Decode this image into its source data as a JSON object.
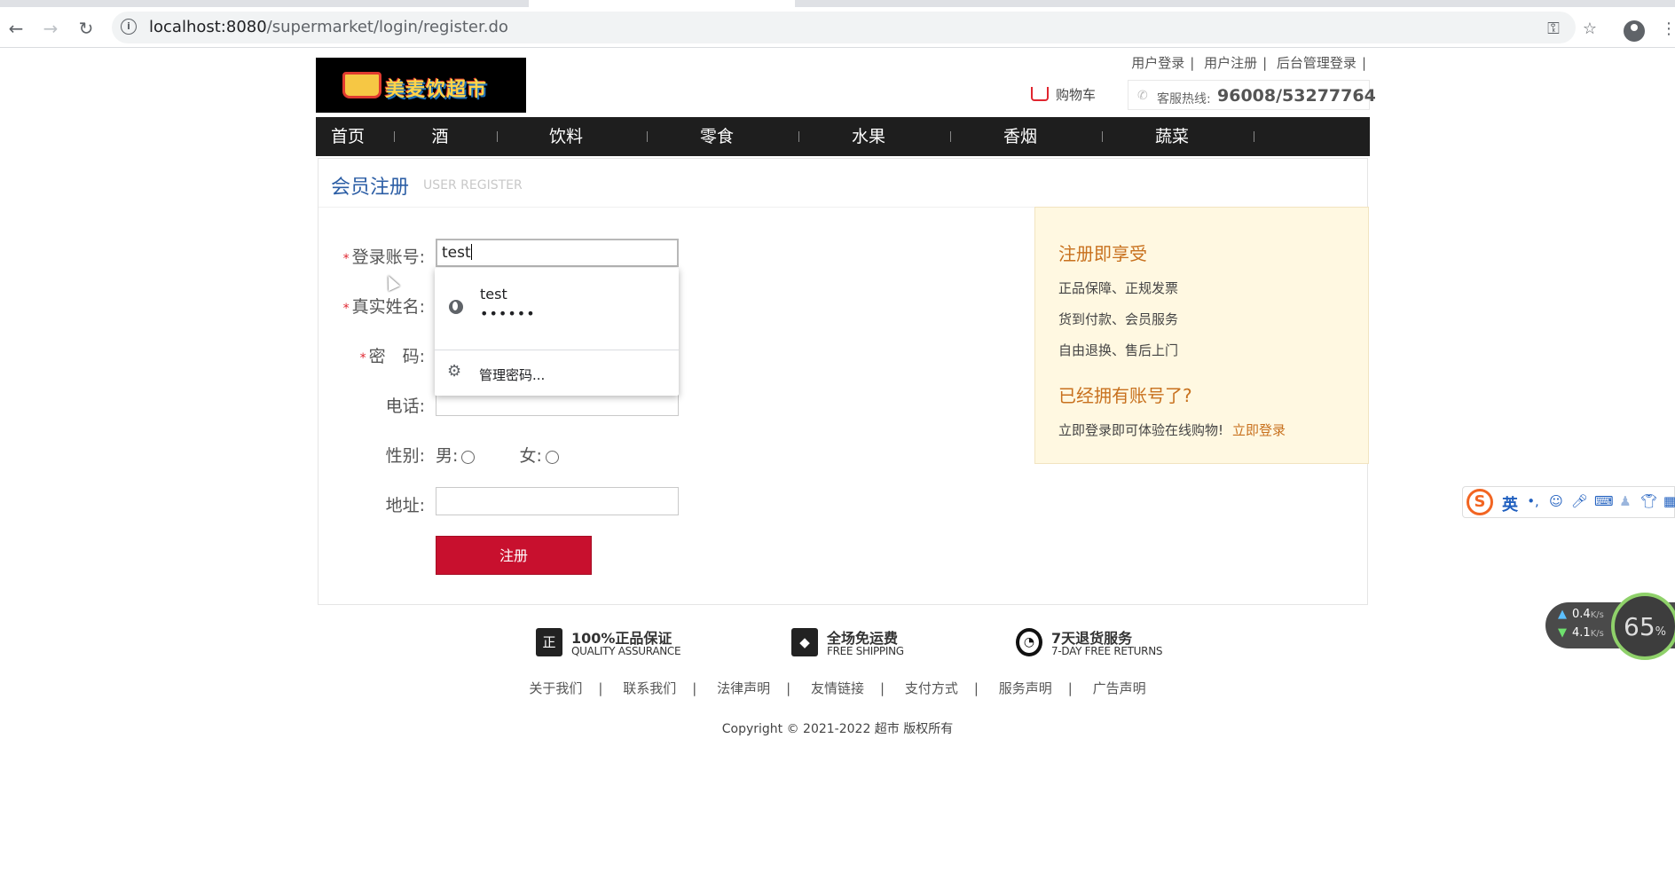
{
  "browser": {
    "url_host": "localhost:8080",
    "url_path": "/supermarket/login/register.do"
  },
  "header": {
    "logo_text": "美麦饮超市",
    "top_links": [
      "用户登录",
      "用户注册",
      "后台管理登录"
    ],
    "cart_label": "购物车",
    "hotline_label": "客服热线:",
    "hotline_number": "96008/53277764"
  },
  "nav": {
    "items": [
      "首页",
      "酒",
      "饮料",
      "零食",
      "水果",
      "香烟",
      "蔬菜"
    ]
  },
  "register": {
    "title": "会员注册",
    "subtitle": "USER REGISTER",
    "account_label": "登录账号:",
    "account_value": "test",
    "realname_label": "真实姓名:",
    "password_label": "密　码:",
    "phone_label": "电话:",
    "gender_label": "性别:",
    "gender_male": "男:",
    "gender_female": "女:",
    "address_label": "地址:",
    "submit_label": "注册",
    "required_mark": "*"
  },
  "side": {
    "heading1": "注册即享受",
    "benefits": [
      "正品保障、正规发票",
      "货到付款、会员服务",
      "自由退换、售后上门"
    ],
    "heading2": "已经拥有账号了?",
    "login_text": "立即登录即可体验在线购物!",
    "login_link": "立即登录"
  },
  "autofill": {
    "username": "test",
    "password_mask": "••••••",
    "manage_label": "管理密码..."
  },
  "footer": {
    "badges": [
      {
        "title": "100%正品保证",
        "subtitle": "QUALITY ASSURANCE",
        "icon": "正"
      },
      {
        "title": "全场免运费",
        "subtitle": "FREE SHIPPING",
        "icon": "box-icon"
      },
      {
        "title": "7天退货服务",
        "subtitle": "7-DAY FREE RETURNS",
        "icon": "clock-icon"
      }
    ],
    "links": [
      "关于我们",
      "联系我们",
      "法律声明",
      "友情链接",
      "支付方式",
      "服务声明",
      "广告声明"
    ],
    "copyright": "Copyright © 2021-2022 超市 版权所有"
  },
  "ime": {
    "logo": "S",
    "mode": "英"
  },
  "net_widget": {
    "up": "0.4",
    "down": "4.1",
    "unit": "K/s",
    "percent": "65",
    "percent_symbol": "%"
  }
}
